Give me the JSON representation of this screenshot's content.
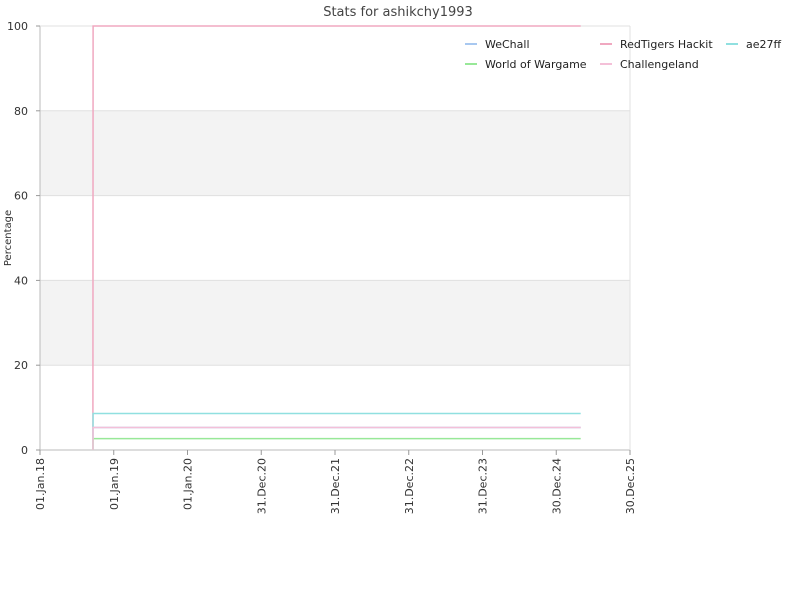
{
  "chart_data": {
    "type": "line",
    "title": "Stats for ashikchy1993",
    "xlabel": "",
    "ylabel": "Percentage",
    "ylim": [
      0,
      100
    ],
    "xlim": [
      "2018-01-01",
      "2025-12-30"
    ],
    "y_ticks": [
      0,
      20,
      40,
      60,
      80,
      100
    ],
    "x_ticks": [
      {
        "date": "2018-01-01",
        "label": "01.Jan.18"
      },
      {
        "date": "2019-01-01",
        "label": "01.Jan.19"
      },
      {
        "date": "2020-01-01",
        "label": "01.Jan.20"
      },
      {
        "date": "2020-12-31",
        "label": "31.Dec.20"
      },
      {
        "date": "2021-12-31",
        "label": "31.Dec.21"
      },
      {
        "date": "2022-12-31",
        "label": "31.Dec.22"
      },
      {
        "date": "2023-12-31",
        "label": "31.Dec.23"
      },
      {
        "date": "2024-12-30",
        "label": "30.Dec.24"
      },
      {
        "date": "2025-12-30",
        "label": "30.Dec.25"
      }
    ],
    "grid": true,
    "alternating_bands": true,
    "legend_position": "top-right",
    "series": [
      {
        "name": "WeChall",
        "color": "#a8c8f0",
        "points": [
          [
            "2018-09-20",
            0
          ],
          [
            "2018-09-21",
            5.3
          ],
          [
            "2025-04-30",
            5.3
          ]
        ]
      },
      {
        "name": "RedTigers Hackit",
        "color": "#f0a8c0",
        "points": [
          [
            "2018-09-20",
            0
          ],
          [
            "2018-09-21",
            100
          ],
          [
            "2025-04-30",
            100
          ]
        ]
      },
      {
        "name": "ae27ff",
        "color": "#90e0e0",
        "points": [
          [
            "2018-09-20",
            0
          ],
          [
            "2018-09-21",
            8.6
          ],
          [
            "2025-04-30",
            8.6
          ]
        ]
      },
      {
        "name": "World of Wargame",
        "color": "#98e898",
        "points": [
          [
            "2018-09-20",
            0
          ],
          [
            "2018-09-21",
            2.7
          ],
          [
            "2025-04-30",
            2.7
          ]
        ]
      },
      {
        "name": "Challengeland",
        "color": "#f4c0d8",
        "points": [
          [
            "2018-09-20",
            0
          ],
          [
            "2018-09-21",
            5.3
          ],
          [
            "2025-04-30",
            5.3
          ]
        ]
      }
    ]
  }
}
